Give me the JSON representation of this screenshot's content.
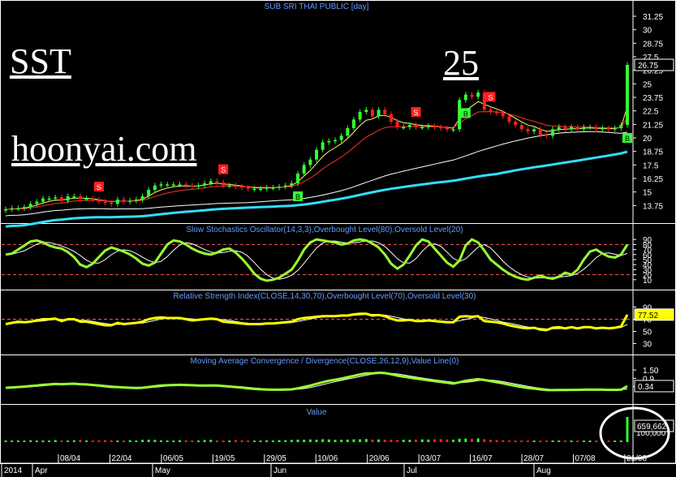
{
  "watermark": {
    "symbol": "SST",
    "price": "25",
    "site": "hoonyai.com"
  },
  "colors": {
    "bg": "#000000",
    "up": "#33ff33",
    "down": "#ff2020",
    "title": "#6699ff",
    "axis": "#ffffff",
    "ema_fast": "#ffff66",
    "ema_mid": "#ff3030",
    "ema_slow": "#ffffff",
    "ema_long": "#33ddff",
    "stoch_k": "#99ff33",
    "rsi": "#ffff00",
    "macd": "#99ff33",
    "signal_label_b": "#33ff33",
    "signal_label_s": "#ff2020"
  },
  "chart_data": [
    {
      "type": "candlestick",
      "title": "SUB SRI THAI PUBLIC [day]",
      "ylim": [
        12.5,
        32
      ],
      "yticks": [
        "13.75",
        "15",
        "16.25",
        "17.5",
        "18.75",
        "20",
        "21.25",
        "22.5",
        "23.75",
        "25",
        "26.25",
        "27.5",
        "28.75",
        "30",
        "31.25"
      ],
      "last_value": "26.75",
      "x_date_labels": [
        "08/04",
        "22/04",
        "06/05",
        "19/05",
        "29/05",
        "10/06",
        "20/06",
        "03/07",
        "16/07",
        "28/07",
        "07/08",
        "21/08"
      ],
      "x_month_labels": [
        "2014",
        "Apr",
        "May",
        "Jun",
        "Jul",
        "Aug"
      ],
      "signals": [
        {
          "label": "S",
          "bar": 15
        },
        {
          "label": "S",
          "bar": 35
        },
        {
          "label": "B",
          "bar": 47
        },
        {
          "label": "S",
          "bar": 66
        },
        {
          "label": "B",
          "bar": 74
        },
        {
          "label": "S",
          "bar": 78
        },
        {
          "label": "B",
          "bar": 100
        }
      ],
      "ohlc": {
        "open": [
          13.3,
          13.4,
          13.5,
          13.5,
          13.6,
          13.9,
          14.1,
          14.4,
          14.4,
          14.5,
          14.2,
          14.6,
          14.6,
          14.4,
          14.4,
          14.3,
          14.1,
          14.0,
          13.9,
          14.3,
          14.1,
          14.2,
          14.3,
          14.6,
          15.2,
          15.6,
          15.7,
          15.7,
          15.7,
          15.7,
          15.6,
          15.5,
          15.6,
          15.8,
          16.0,
          15.9,
          15.6,
          15.6,
          15.5,
          15.4,
          15.3,
          15.3,
          15.3,
          15.4,
          15.4,
          15.5,
          15.6,
          15.8,
          16.7,
          17.5,
          18.0,
          18.9,
          19.6,
          19.7,
          19.8,
          20.2,
          20.9,
          21.7,
          22.4,
          22.6,
          22.0,
          22.6,
          22.2,
          21.5,
          21.0,
          21.0,
          21.2,
          21.0,
          21.0,
          21.1,
          21.0,
          20.9,
          20.8,
          20.8,
          23.5,
          24.0,
          23.8,
          24.2,
          22.6,
          22.4,
          22.3,
          22.0,
          21.5,
          21.2,
          20.8,
          20.6,
          20.8,
          20.3,
          20.2,
          20.8,
          21.0,
          20.8,
          21.0,
          20.8,
          21.0,
          21.0,
          20.8,
          20.9,
          20.8,
          20.9,
          21.2
        ],
        "close": [
          13.4,
          13.5,
          13.5,
          13.6,
          13.9,
          14.1,
          14.4,
          14.4,
          14.5,
          14.2,
          14.6,
          14.6,
          14.4,
          14.4,
          14.3,
          14.1,
          14.0,
          13.9,
          14.3,
          14.1,
          14.2,
          14.3,
          14.6,
          15.2,
          15.6,
          15.7,
          15.7,
          15.7,
          15.7,
          15.6,
          15.5,
          15.6,
          15.8,
          16.0,
          15.9,
          15.6,
          15.6,
          15.5,
          15.4,
          15.3,
          15.3,
          15.3,
          15.4,
          15.4,
          15.5,
          15.6,
          15.8,
          16.7,
          17.5,
          18.0,
          18.9,
          19.6,
          19.7,
          19.8,
          20.2,
          20.9,
          21.7,
          22.4,
          22.6,
          22.0,
          22.6,
          22.2,
          21.5,
          21.0,
          21.0,
          21.2,
          21.0,
          21.0,
          21.1,
          21.0,
          20.9,
          20.8,
          20.8,
          23.5,
          24.0,
          23.8,
          24.2,
          22.6,
          22.4,
          22.3,
          22.0,
          21.5,
          21.2,
          20.8,
          20.6,
          20.8,
          20.3,
          20.2,
          20.8,
          21.0,
          20.8,
          21.0,
          20.8,
          21.0,
          21.0,
          20.8,
          20.9,
          20.8,
          20.9,
          21.2,
          26.75
        ]
      }
    },
    {
      "type": "line",
      "title": "Slow Stochastics Oscillator(14,3,3),Overbought Level(80),Oversold Level(20)",
      "ylim": [
        0,
        100
      ],
      "yticks": [
        "10",
        "20",
        "30",
        "40",
        "50",
        "60",
        "70",
        "80",
        "90"
      ],
      "levels": [
        80,
        20
      ],
      "series": [
        {
          "values": [
            60,
            62,
            70,
            78,
            86,
            88,
            84,
            78,
            74,
            72,
            65,
            55,
            40,
            35,
            42,
            55,
            68,
            74,
            70,
            66,
            60,
            52,
            42,
            38,
            44,
            62,
            80,
            88,
            86,
            80,
            72,
            66,
            62,
            60,
            64,
            70,
            72,
            64,
            52,
            38,
            22,
            12,
            8,
            10,
            14,
            22,
            30,
            48,
            70,
            84,
            90,
            88,
            86,
            84,
            80,
            82,
            88,
            90,
            88,
            82,
            74,
            60,
            42,
            32,
            40,
            58,
            78,
            90,
            86,
            72,
            58,
            44,
            36,
            48,
            78,
            90,
            84,
            68,
            50,
            40,
            30,
            22,
            16,
            12,
            10,
            14,
            18,
            14,
            12,
            16,
            24,
            20,
            30,
            50,
            66,
            70,
            62,
            56,
            54,
            60,
            80
          ]
        }
      ]
    },
    {
      "type": "line",
      "title": "Relative Strength Index(CLOSE,14,30,70),Overbought Level(70),Oversold Level(30)",
      "ylim": [
        20,
        100
      ],
      "yticks": [
        "30",
        "50",
        "70",
        "90"
      ],
      "levels": [
        70
      ],
      "last_value": "77.52",
      "series": [
        {
          "values": [
            62,
            64,
            66,
            65,
            66,
            68,
            70,
            70,
            71,
            67,
            70,
            70,
            66,
            66,
            64,
            62,
            60,
            60,
            64,
            62,
            63,
            64,
            66,
            70,
            72,
            73,
            72,
            72,
            72,
            70,
            68,
            69,
            70,
            71,
            70,
            66,
            65,
            64,
            63,
            62,
            62,
            62,
            63,
            63,
            64,
            65,
            66,
            70,
            72,
            73,
            74,
            75,
            75,
            75,
            76,
            76,
            78,
            79,
            79,
            76,
            77,
            75,
            71,
            68,
            68,
            69,
            67,
            67,
            68,
            67,
            66,
            65,
            65,
            74,
            75,
            74,
            75,
            67,
            66,
            65,
            63,
            60,
            58,
            56,
            55,
            56,
            53,
            52,
            56,
            57,
            55,
            57,
            55,
            57,
            57,
            55,
            56,
            55,
            56,
            58,
            77.52
          ]
        }
      ]
    },
    {
      "type": "line",
      "title": "Moving Average Convergence / Divergence(CLOSE,26,12,9),Value Line(0)",
      "ylim": [
        -0.6,
        1.8
      ],
      "yticks": [
        "0.3",
        "0.9",
        "1.50"
      ],
      "last_value": "0.34",
      "series": [
        {
          "values": [
            0.22,
            0.24,
            0.27,
            0.3,
            0.34,
            0.38,
            0.43,
            0.46,
            0.5,
            0.48,
            0.5,
            0.51,
            0.48,
            0.46,
            0.42,
            0.38,
            0.33,
            0.28,
            0.27,
            0.24,
            0.22,
            0.21,
            0.22,
            0.27,
            0.33,
            0.38,
            0.4,
            0.42,
            0.43,
            0.42,
            0.4,
            0.38,
            0.38,
            0.39,
            0.38,
            0.34,
            0.31,
            0.27,
            0.23,
            0.18,
            0.14,
            0.11,
            0.09,
            0.08,
            0.08,
            0.09,
            0.1,
            0.18,
            0.28,
            0.38,
            0.5,
            0.62,
            0.72,
            0.8,
            0.88,
            0.98,
            1.08,
            1.18,
            1.26,
            1.26,
            1.3,
            1.28,
            1.2,
            1.1,
            1.02,
            0.96,
            0.88,
            0.82,
            0.76,
            0.7,
            0.64,
            0.58,
            0.52,
            0.62,
            0.72,
            0.78,
            0.84,
            0.78,
            0.7,
            0.62,
            0.54,
            0.44,
            0.36,
            0.28,
            0.2,
            0.16,
            0.1,
            0.06,
            0.05,
            0.06,
            0.06,
            0.07,
            0.07,
            0.08,
            0.09,
            0.08,
            0.08,
            0.07,
            0.07,
            0.08,
            0.34
          ]
        }
      ]
    },
    {
      "type": "bar",
      "title": "Value",
      "yticks": [
        "100,000"
      ],
      "last_value": "659,662",
      "values": [
        40,
        35,
        45,
        30,
        50,
        38,
        42,
        36,
        55,
        44,
        30,
        48,
        62,
        40,
        38,
        44,
        52,
        46,
        40,
        35,
        50,
        42,
        60,
        64,
        58,
        48,
        44,
        40,
        52,
        46,
        40,
        38,
        56,
        60,
        44,
        40,
        38,
        52,
        46,
        42,
        36,
        40,
        48,
        44,
        52,
        50,
        58,
        66,
        62,
        70,
        64,
        76,
        70,
        60,
        62,
        66,
        72,
        74,
        80,
        68,
        70,
        64,
        58,
        56,
        62,
        60,
        66,
        72,
        68,
        74,
        80,
        70,
        64,
        88,
        92,
        84,
        96,
        76,
        60,
        56,
        48,
        44,
        40,
        42,
        38,
        40,
        36,
        38,
        44,
        40,
        42,
        38,
        40,
        36,
        38,
        40,
        36,
        38,
        40,
        44,
        659.662
      ]
    }
  ]
}
